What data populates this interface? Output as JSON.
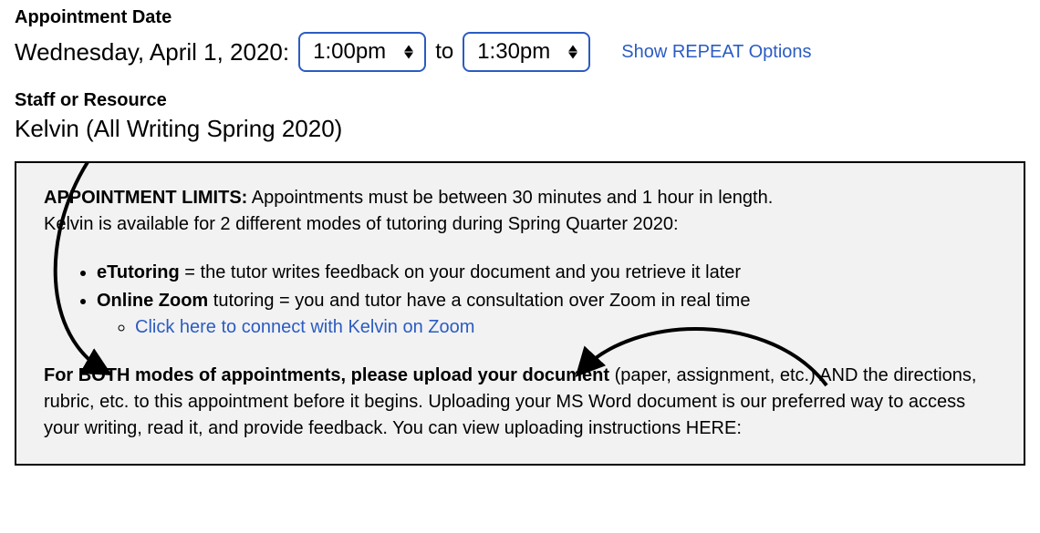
{
  "appointment": {
    "date_label": "Appointment Date",
    "date_text": "Wednesday, April 1, 2020:",
    "start_time": "1:00pm",
    "to_text": "to",
    "end_time": "1:30pm",
    "repeat_link": "Show REPEAT Options"
  },
  "staff": {
    "label": "Staff or Resource",
    "value": "Kelvin (All Writing Spring 2020)"
  },
  "info": {
    "limits_label": "APPOINTMENT LIMITS:",
    "limits_text": "Appointments must be between 30 minutes and 1 hour in length.",
    "availability_text": "Kelvin is available for 2 different modes of tutoring during Spring Quarter 2020:",
    "modes": {
      "etutoring_label": "eTutoring",
      "etutoring_desc": " = the tutor writes feedback on your document and you retrieve it later",
      "zoom_label": "Online Zoom",
      "zoom_desc": " tutoring = you and tutor have a consultation over Zoom in real time",
      "zoom_link": "Click here to connect with Kelvin on Zoom"
    },
    "upload_bold": "For BOTH modes of appointments, please upload your document",
    "upload_rest": " (paper, assignment, etc.) AND the directions, rubric, etc. to this appointment before it begins. Uploading your MS Word document is our preferred way to access your writing, read it, and provide feedback. You can view uploading instructions HERE:"
  }
}
